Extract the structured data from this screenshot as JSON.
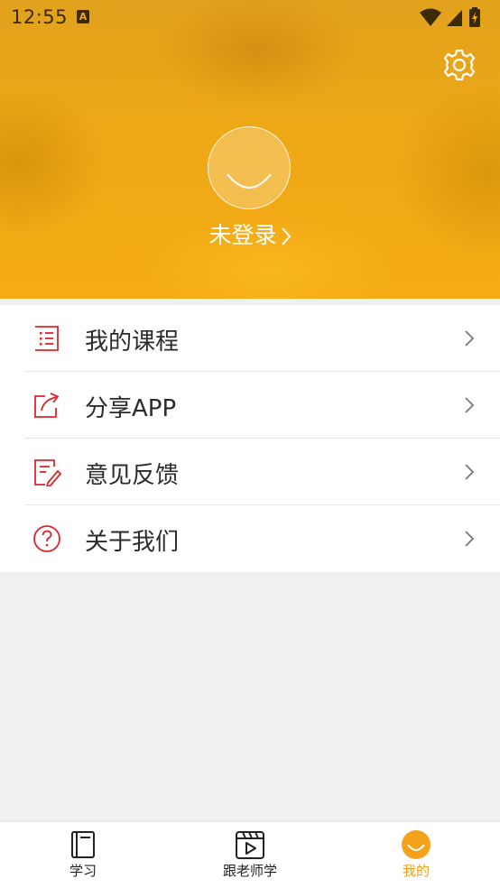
{
  "status_bar": {
    "time": "12:55",
    "notification_badge": "A"
  },
  "header": {
    "settings_icon": "gear-icon",
    "avatar_icon": "smiley-face-icon",
    "login_label": "未登录",
    "accent_color": "#efa816"
  },
  "menu": {
    "items": [
      {
        "label": "我的课程",
        "icon": "list-icon"
      },
      {
        "label": "分享APP",
        "icon": "share-icon"
      },
      {
        "label": "意见反馈",
        "icon": "feedback-edit-icon"
      },
      {
        "label": "关于我们",
        "icon": "question-circle-icon"
      }
    ],
    "icon_color": "#e0242b"
  },
  "tab_bar": {
    "tabs": [
      {
        "label": "学习",
        "icon": "book-icon",
        "active": false
      },
      {
        "label": "跟老师学",
        "icon": "video-play-icon",
        "active": false
      },
      {
        "label": "我的",
        "icon": "smiley-face-icon",
        "active": true
      }
    ],
    "active_color": "#f4a21a"
  }
}
